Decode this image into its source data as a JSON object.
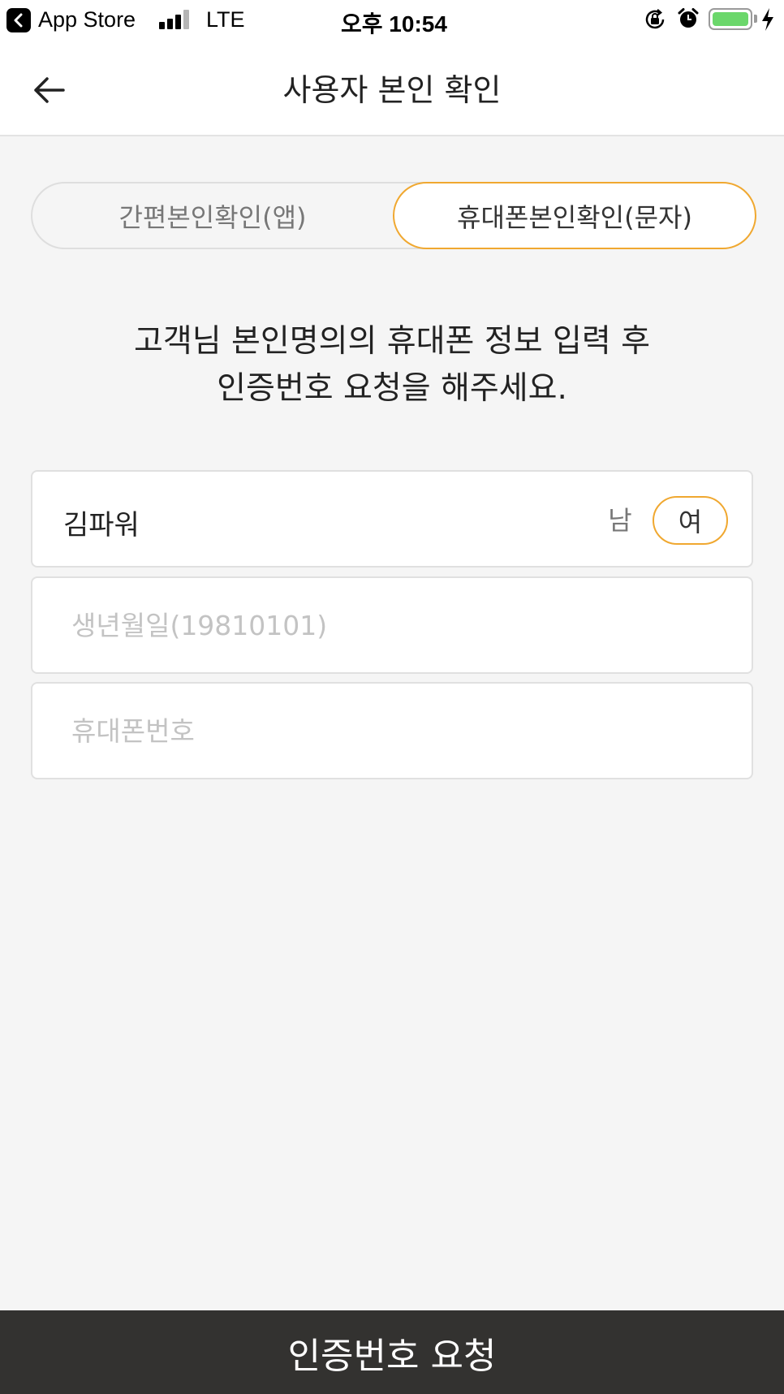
{
  "status_bar": {
    "back_app": "App Store",
    "network": "LTE",
    "time": "오후 10:54",
    "battery_color": "#6bd76b"
  },
  "header": {
    "title": "사용자 본인 확인",
    "back_icon": "arrow-left-icon"
  },
  "tabs": [
    {
      "label": "간편본인확인(앱)",
      "selected": false
    },
    {
      "label": "휴대폰본인확인(문자)",
      "selected": true
    }
  ],
  "instruction": {
    "line1": "고객님 본인명의의 휴대폰 정보 입력 후",
    "line2": "인증번호 요청을 해주세요."
  },
  "form": {
    "name": "김파워",
    "gender_options": [
      {
        "label": "남",
        "selected": false
      },
      {
        "label": "여",
        "selected": true
      }
    ],
    "birthdate": {
      "value": "",
      "placeholder": "생년월일(19810101)"
    },
    "phone": {
      "value": "",
      "placeholder": "휴대폰번호"
    }
  },
  "submit_label": "인증번호 요청",
  "colors": {
    "accent": "#f0a830",
    "button_bg": "#333230",
    "page_bg": "#f5f5f5"
  }
}
